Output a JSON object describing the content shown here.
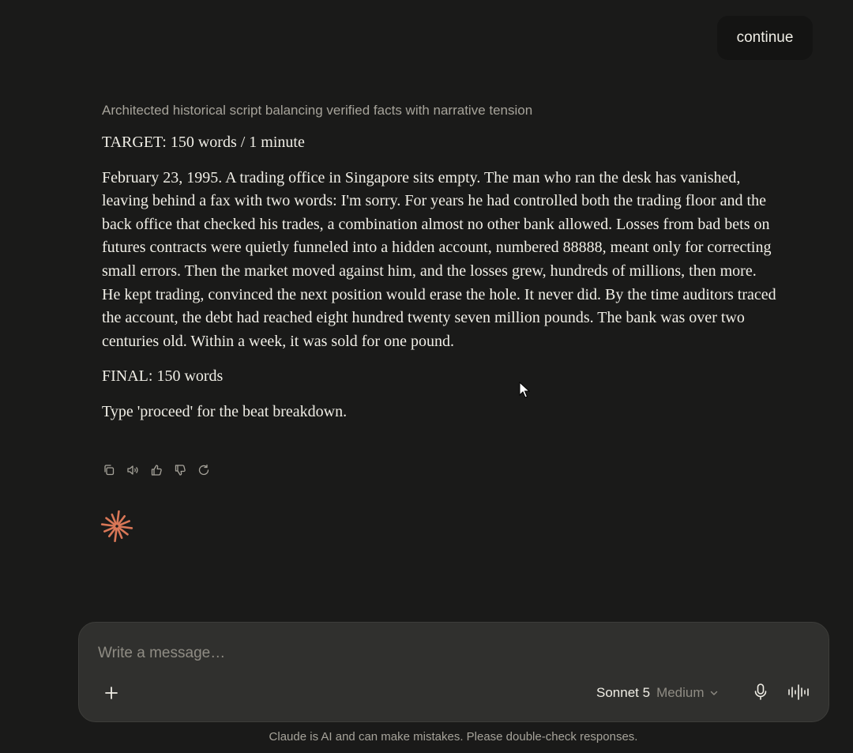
{
  "user_message": {
    "text": "continue"
  },
  "assistant_message": {
    "thinking_summary": "Architected historical script balancing verified facts with narrative tension",
    "target_line": "TARGET: 150 words / 1 minute",
    "script": "February 23, 1995. A trading office in Singapore sits empty. The man who ran the desk has vanished, leaving behind a fax with two words: I'm sorry. For years he had controlled both the trading floor and the back office that checked his trades, a combination almost no other bank allowed. Losses from bad bets on futures contracts were quietly funneled into a hidden account, numbered 88888, meant only for correcting small errors. Then the market moved against him, and the losses grew, hundreds of millions, then more. He kept trading, convinced the next position would erase the hole. It never did. By the time auditors traced the account, the debt had reached eight hundred twenty seven million pounds. The bank was over two centuries old. Within a week, it was sold for one pound.",
    "final_line": "FINAL: 150 words",
    "instruction_line": "Type 'proceed' for the beat breakdown."
  },
  "message_actions": [
    {
      "icon": "copy-icon"
    },
    {
      "icon": "speaker-icon"
    },
    {
      "icon": "thumbs-up-icon"
    },
    {
      "icon": "thumbs-down-icon"
    },
    {
      "icon": "retry-icon"
    }
  ],
  "loading_indicator": {
    "icon": "claude-spark-icon",
    "color": "#d97757"
  },
  "composer": {
    "placeholder": "Write a message…",
    "value": "",
    "model_name": "Sonnet 5",
    "model_effort": "Medium"
  },
  "footer": {
    "disclaimer": "Claude is AI and can make mistakes. Please double-check responses."
  },
  "colors": {
    "background": "#1a1a19",
    "user_bubble": "#141413",
    "composer": "#30302e",
    "text": "#f0eee6",
    "muted_text": "#a6a39a",
    "accent": "#d97757"
  }
}
